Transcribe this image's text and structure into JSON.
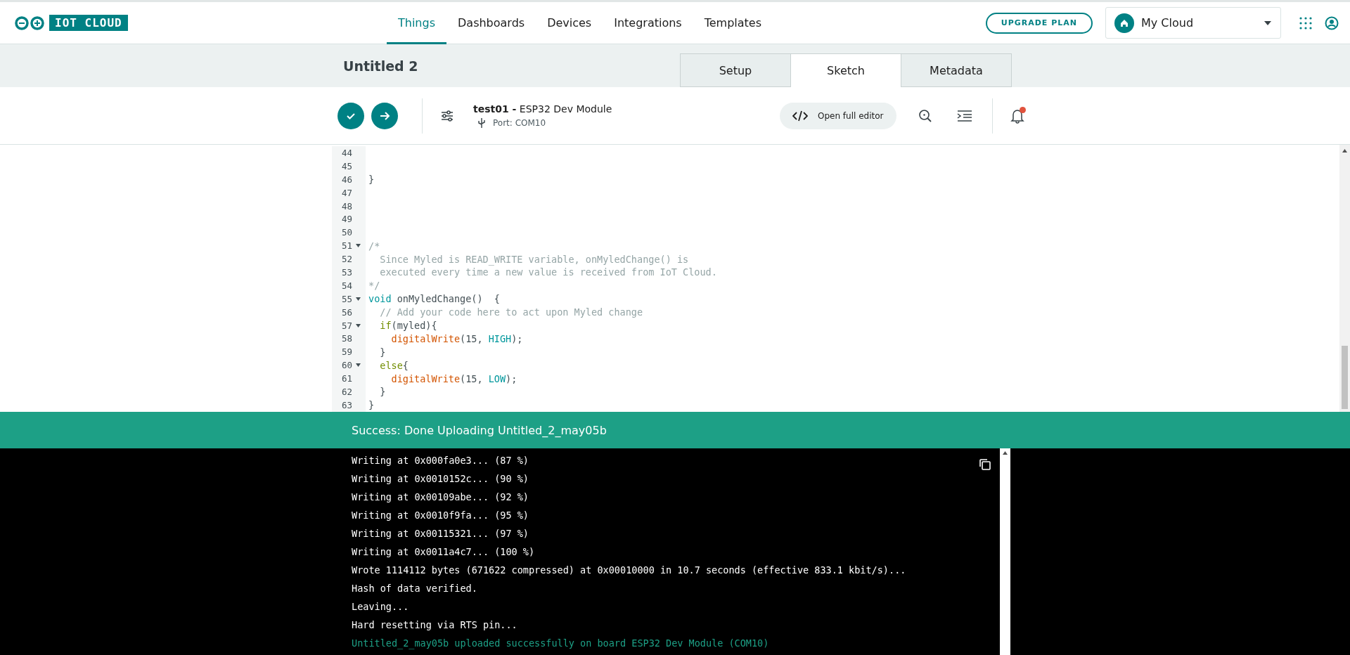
{
  "logo": {
    "text": "IOT CLOUD"
  },
  "nav": [
    {
      "label": "Things",
      "selected": true
    },
    {
      "label": "Dashboards",
      "selected": false
    },
    {
      "label": "Devices",
      "selected": false
    },
    {
      "label": "Integrations",
      "selected": false
    },
    {
      "label": "Templates",
      "selected": false
    }
  ],
  "upgrade_button": "UPGRADE PLAN",
  "space_select": {
    "value": "My Cloud"
  },
  "thing_title": "Untitled 2",
  "tabs": [
    {
      "label": "Setup",
      "selected": false
    },
    {
      "label": "Sketch",
      "selected": true
    },
    {
      "label": "Metadata",
      "selected": false
    }
  ],
  "toolbar": {
    "sketch_name": "test01 -",
    "board": "ESP32 Dev Module",
    "port": "Port: COM10",
    "full_editor_button": "Open full editor",
    "notification_unread": true
  },
  "code_lines": [
    {
      "number": "44",
      "foldable": false
    },
    {
      "number": "45",
      "foldable": false
    },
    {
      "number": "46",
      "foldable": false,
      "tokens": [
        {
          "kind": "plain",
          "text": "}"
        }
      ]
    },
    {
      "number": "47",
      "foldable": false
    },
    {
      "number": "48",
      "foldable": false
    },
    {
      "number": "49",
      "foldable": false
    },
    {
      "number": "50",
      "foldable": false
    },
    {
      "number": "51",
      "foldable": true,
      "tokens": [
        {
          "kind": "comment",
          "text": "/*"
        }
      ]
    },
    {
      "number": "52",
      "foldable": false,
      "tokens": [
        {
          "kind": "comment",
          "text": "  Since Myled is READ_WRITE variable, onMyledChange() is"
        }
      ]
    },
    {
      "number": "53",
      "foldable": false,
      "tokens": [
        {
          "kind": "comment",
          "text": "  executed every time a new value is received from IoT Cloud."
        }
      ]
    },
    {
      "number": "54",
      "foldable": false,
      "tokens": [
        {
          "kind": "comment",
          "text": "*/"
        }
      ]
    },
    {
      "number": "55",
      "foldable": true,
      "tokens": [
        {
          "kind": "keyword",
          "text": "void"
        },
        {
          "kind": "plain",
          "text": " onMyledChange()  {"
        }
      ]
    },
    {
      "number": "56",
      "foldable": false,
      "tokens": [
        {
          "kind": "comment",
          "text": "  // Add your code here to act upon Myled change"
        }
      ]
    },
    {
      "number": "57",
      "foldable": true,
      "tokens": [
        {
          "kind": "control",
          "text": "  if"
        },
        {
          "kind": "plain",
          "text": "(myled){"
        }
      ]
    },
    {
      "number": "58",
      "foldable": false,
      "tokens": [
        {
          "kind": "function",
          "text": "    digitalWrite"
        },
        {
          "kind": "plain",
          "text": "(15, "
        },
        {
          "kind": "constant",
          "text": "HIGH"
        },
        {
          "kind": "plain",
          "text": ");"
        }
      ]
    },
    {
      "number": "59",
      "foldable": false,
      "tokens": [
        {
          "kind": "plain",
          "text": "  }"
        }
      ]
    },
    {
      "number": "60",
      "foldable": true,
      "tokens": [
        {
          "kind": "control",
          "text": "  else"
        },
        {
          "kind": "plain",
          "text": "{"
        }
      ]
    },
    {
      "number": "61",
      "foldable": false,
      "tokens": [
        {
          "kind": "function",
          "text": "    digitalWrite"
        },
        {
          "kind": "plain",
          "text": "(15, "
        },
        {
          "kind": "constant",
          "text": "LOW"
        },
        {
          "kind": "plain",
          "text": ");"
        }
      ]
    },
    {
      "number": "62",
      "foldable": false,
      "tokens": [
        {
          "kind": "plain",
          "text": "  }"
        }
      ]
    },
    {
      "number": "63",
      "foldable": false,
      "tokens": [
        {
          "kind": "plain",
          "text": "}"
        }
      ]
    }
  ],
  "status_bar": {
    "message": "Success: Done Uploading Untitled_2_may05b"
  },
  "console_lines": [
    {
      "kind": "output",
      "text": "Writing at 0x000fa0e3... (87 %)"
    },
    {
      "kind": "output",
      "text": "Writing at 0x0010152c... (90 %)"
    },
    {
      "kind": "output",
      "text": "Writing at 0x00109abe... (92 %)"
    },
    {
      "kind": "output",
      "text": "Writing at 0x0010f9fa... (95 %)"
    },
    {
      "kind": "output",
      "text": "Writing at 0x00115321... (97 %)"
    },
    {
      "kind": "output",
      "text": "Writing at 0x0011a4c7... (100 %)"
    },
    {
      "kind": "output",
      "text": "Wrote 1114112 bytes (671622 compressed) at 0x00010000 in 10.7 seconds (effective 833.1 kbit/s)..."
    },
    {
      "kind": "output",
      "text": "Hash of data verified."
    },
    {
      "kind": "output",
      "text": "Leaving..."
    },
    {
      "kind": "output",
      "text": "Hard resetting via RTS pin..."
    },
    {
      "kind": "success",
      "text": "Untitled_2_may05b uploaded successfully on board ESP32 Dev Module (COM10)"
    }
  ]
}
